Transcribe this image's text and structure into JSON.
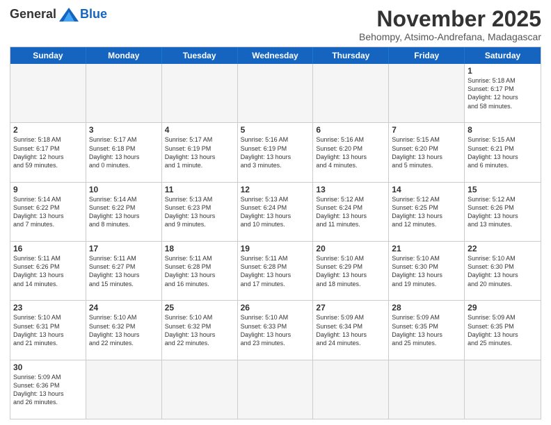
{
  "logo": {
    "general": "General",
    "blue": "Blue"
  },
  "title": "November 2025",
  "location": "Behompy, Atsimo-Andrefana, Madagascar",
  "header_days": [
    "Sunday",
    "Monday",
    "Tuesday",
    "Wednesday",
    "Thursday",
    "Friday",
    "Saturday"
  ],
  "rows": [
    [
      {
        "day": "",
        "text": "",
        "empty": true
      },
      {
        "day": "",
        "text": "",
        "empty": true
      },
      {
        "day": "",
        "text": "",
        "empty": true
      },
      {
        "day": "",
        "text": "",
        "empty": true
      },
      {
        "day": "",
        "text": "",
        "empty": true
      },
      {
        "day": "",
        "text": "",
        "empty": true
      },
      {
        "day": "1",
        "text": "Sunrise: 5:18 AM\nSunset: 6:17 PM\nDaylight: 12 hours\nand 58 minutes.",
        "empty": false
      }
    ],
    [
      {
        "day": "2",
        "text": "Sunrise: 5:18 AM\nSunset: 6:17 PM\nDaylight: 12 hours\nand 59 minutes.",
        "empty": false
      },
      {
        "day": "3",
        "text": "Sunrise: 5:17 AM\nSunset: 6:18 PM\nDaylight: 13 hours\nand 0 minutes.",
        "empty": false
      },
      {
        "day": "4",
        "text": "Sunrise: 5:17 AM\nSunset: 6:19 PM\nDaylight: 13 hours\nand 1 minute.",
        "empty": false
      },
      {
        "day": "5",
        "text": "Sunrise: 5:16 AM\nSunset: 6:19 PM\nDaylight: 13 hours\nand 3 minutes.",
        "empty": false
      },
      {
        "day": "6",
        "text": "Sunrise: 5:16 AM\nSunset: 6:20 PM\nDaylight: 13 hours\nand 4 minutes.",
        "empty": false
      },
      {
        "day": "7",
        "text": "Sunrise: 5:15 AM\nSunset: 6:20 PM\nDaylight: 13 hours\nand 5 minutes.",
        "empty": false
      },
      {
        "day": "8",
        "text": "Sunrise: 5:15 AM\nSunset: 6:21 PM\nDaylight: 13 hours\nand 6 minutes.",
        "empty": false
      }
    ],
    [
      {
        "day": "9",
        "text": "Sunrise: 5:14 AM\nSunset: 6:22 PM\nDaylight: 13 hours\nand 7 minutes.",
        "empty": false
      },
      {
        "day": "10",
        "text": "Sunrise: 5:14 AM\nSunset: 6:22 PM\nDaylight: 13 hours\nand 8 minutes.",
        "empty": false
      },
      {
        "day": "11",
        "text": "Sunrise: 5:13 AM\nSunset: 6:23 PM\nDaylight: 13 hours\nand 9 minutes.",
        "empty": false
      },
      {
        "day": "12",
        "text": "Sunrise: 5:13 AM\nSunset: 6:24 PM\nDaylight: 13 hours\nand 10 minutes.",
        "empty": false
      },
      {
        "day": "13",
        "text": "Sunrise: 5:12 AM\nSunset: 6:24 PM\nDaylight: 13 hours\nand 11 minutes.",
        "empty": false
      },
      {
        "day": "14",
        "text": "Sunrise: 5:12 AM\nSunset: 6:25 PM\nDaylight: 13 hours\nand 12 minutes.",
        "empty": false
      },
      {
        "day": "15",
        "text": "Sunrise: 5:12 AM\nSunset: 6:26 PM\nDaylight: 13 hours\nand 13 minutes.",
        "empty": false
      }
    ],
    [
      {
        "day": "16",
        "text": "Sunrise: 5:11 AM\nSunset: 6:26 PM\nDaylight: 13 hours\nand 14 minutes.",
        "empty": false
      },
      {
        "day": "17",
        "text": "Sunrise: 5:11 AM\nSunset: 6:27 PM\nDaylight: 13 hours\nand 15 minutes.",
        "empty": false
      },
      {
        "day": "18",
        "text": "Sunrise: 5:11 AM\nSunset: 6:28 PM\nDaylight: 13 hours\nand 16 minutes.",
        "empty": false
      },
      {
        "day": "19",
        "text": "Sunrise: 5:11 AM\nSunset: 6:28 PM\nDaylight: 13 hours\nand 17 minutes.",
        "empty": false
      },
      {
        "day": "20",
        "text": "Sunrise: 5:10 AM\nSunset: 6:29 PM\nDaylight: 13 hours\nand 18 minutes.",
        "empty": false
      },
      {
        "day": "21",
        "text": "Sunrise: 5:10 AM\nSunset: 6:30 PM\nDaylight: 13 hours\nand 19 minutes.",
        "empty": false
      },
      {
        "day": "22",
        "text": "Sunrise: 5:10 AM\nSunset: 6:30 PM\nDaylight: 13 hours\nand 20 minutes.",
        "empty": false
      }
    ],
    [
      {
        "day": "23",
        "text": "Sunrise: 5:10 AM\nSunset: 6:31 PM\nDaylight: 13 hours\nand 21 minutes.",
        "empty": false
      },
      {
        "day": "24",
        "text": "Sunrise: 5:10 AM\nSunset: 6:32 PM\nDaylight: 13 hours\nand 22 minutes.",
        "empty": false
      },
      {
        "day": "25",
        "text": "Sunrise: 5:10 AM\nSunset: 6:32 PM\nDaylight: 13 hours\nand 22 minutes.",
        "empty": false
      },
      {
        "day": "26",
        "text": "Sunrise: 5:10 AM\nSunset: 6:33 PM\nDaylight: 13 hours\nand 23 minutes.",
        "empty": false
      },
      {
        "day": "27",
        "text": "Sunrise: 5:09 AM\nSunset: 6:34 PM\nDaylight: 13 hours\nand 24 minutes.",
        "empty": false
      },
      {
        "day": "28",
        "text": "Sunrise: 5:09 AM\nSunset: 6:35 PM\nDaylight: 13 hours\nand 25 minutes.",
        "empty": false
      },
      {
        "day": "29",
        "text": "Sunrise: 5:09 AM\nSunset: 6:35 PM\nDaylight: 13 hours\nand 25 minutes.",
        "empty": false
      }
    ],
    [
      {
        "day": "30",
        "text": "Sunrise: 5:09 AM\nSunset: 6:36 PM\nDaylight: 13 hours\nand 26 minutes.",
        "empty": false
      },
      {
        "day": "",
        "text": "",
        "empty": true
      },
      {
        "day": "",
        "text": "",
        "empty": true
      },
      {
        "day": "",
        "text": "",
        "empty": true
      },
      {
        "day": "",
        "text": "",
        "empty": true
      },
      {
        "day": "",
        "text": "",
        "empty": true
      },
      {
        "day": "",
        "text": "",
        "empty": true
      }
    ]
  ]
}
